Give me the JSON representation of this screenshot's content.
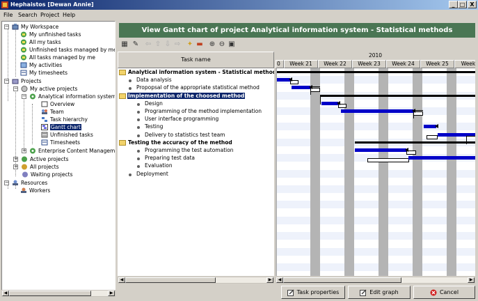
{
  "window": {
    "title": "Hephaistos [Dewan Annie]",
    "controls": {
      "minimize": "_",
      "maximize": "□",
      "close": "X"
    }
  },
  "menu": [
    "File",
    "Search",
    "Project",
    "Help"
  ],
  "tree": {
    "my_workspace": "My Workspace",
    "my_unfinished_tasks": "My unfinished tasks",
    "all_my_tasks": "All my tasks",
    "unfinished_tasks_managed": "Unfinished tasks managed by me",
    "all_tasks_managed": "All tasks managed by me",
    "my_activities": "My activities",
    "my_timesheets": "My timesheets",
    "projects": "Projects",
    "my_active_projects": "My active projects",
    "project_name": "Analytical information system -",
    "overview": "Overview",
    "team": "Team",
    "task_hierarchy": "Task hierarchy",
    "gantt_chart": "Gantt chart",
    "unfinished_tasks": "Unfinished tasks",
    "timesheets": "Timesheets",
    "enterprise_cm": "Enterprise Content Managemen",
    "active_projects": "Active projects",
    "all_projects": "All projects",
    "waiting_projects": "Waiting projects",
    "resources": "Resources",
    "workers": "Workers"
  },
  "banner": "View Gantt chart of project Analytical information system - Statistical methods",
  "task_header": "Task name",
  "gantt_header": {
    "year": "2010",
    "week_prefix_first": "0",
    "weeks": [
      "Week 21",
      "Week 22",
      "Week 23",
      "Week 24",
      "Week 25",
      "Week"
    ]
  },
  "tasks": [
    {
      "label": "Analytical information system - Statistical methods",
      "kind": "root"
    },
    {
      "label": "Data analysis",
      "kind": "task"
    },
    {
      "label": "Propopsal of the appropriate statistical method",
      "kind": "task"
    },
    {
      "label": "Implementation of the choosed method",
      "kind": "group"
    },
    {
      "label": "Design",
      "kind": "subtask"
    },
    {
      "label": "Programming of the method implementation",
      "kind": "subtask"
    },
    {
      "label": "User interface programming",
      "kind": "subtask"
    },
    {
      "label": "Testing",
      "kind": "subtask"
    },
    {
      "label": "Delivery to statistics test team",
      "kind": "subtask"
    },
    {
      "label": "Testing the accuracy of the method",
      "kind": "group"
    },
    {
      "label": "Programming the test automation",
      "kind": "subtask"
    },
    {
      "label": "Preparing test data",
      "kind": "subtask"
    },
    {
      "label": "Evaluation",
      "kind": "subtask"
    },
    {
      "label": "Deployment",
      "kind": "task"
    }
  ],
  "buttons": {
    "task_properties": "Task properties",
    "edit_graph": "Edit graph",
    "cancel": "Cancel"
  },
  "colors": {
    "banner": "#4a7654",
    "task_bar": "#0000c8",
    "selection": "#0a246a"
  }
}
